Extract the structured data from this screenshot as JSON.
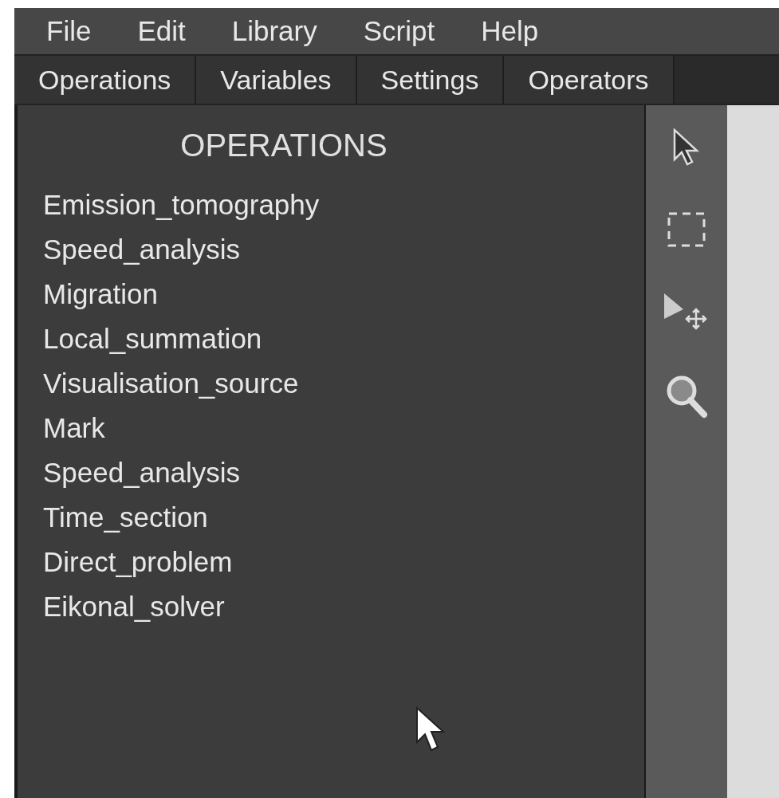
{
  "menu": [
    "File",
    "Edit",
    "Library",
    "Script",
    "Help"
  ],
  "tabs": [
    "Operations",
    "Variables",
    "Settings",
    "Operators"
  ],
  "panel": {
    "title": "OPERATIONS",
    "items": [
      "Emission_tomography",
      "Speed_analysis",
      "Migration",
      "Local_summation",
      "Visualisation_source",
      "Mark",
      "Speed_analysis",
      "Time_section",
      "Direct_problem",
      "Eikonal_solver"
    ]
  },
  "tools": [
    {
      "kind": "pointer"
    },
    {
      "kind": "marquee"
    },
    {
      "kind": "move"
    },
    {
      "kind": "zoom"
    }
  ]
}
